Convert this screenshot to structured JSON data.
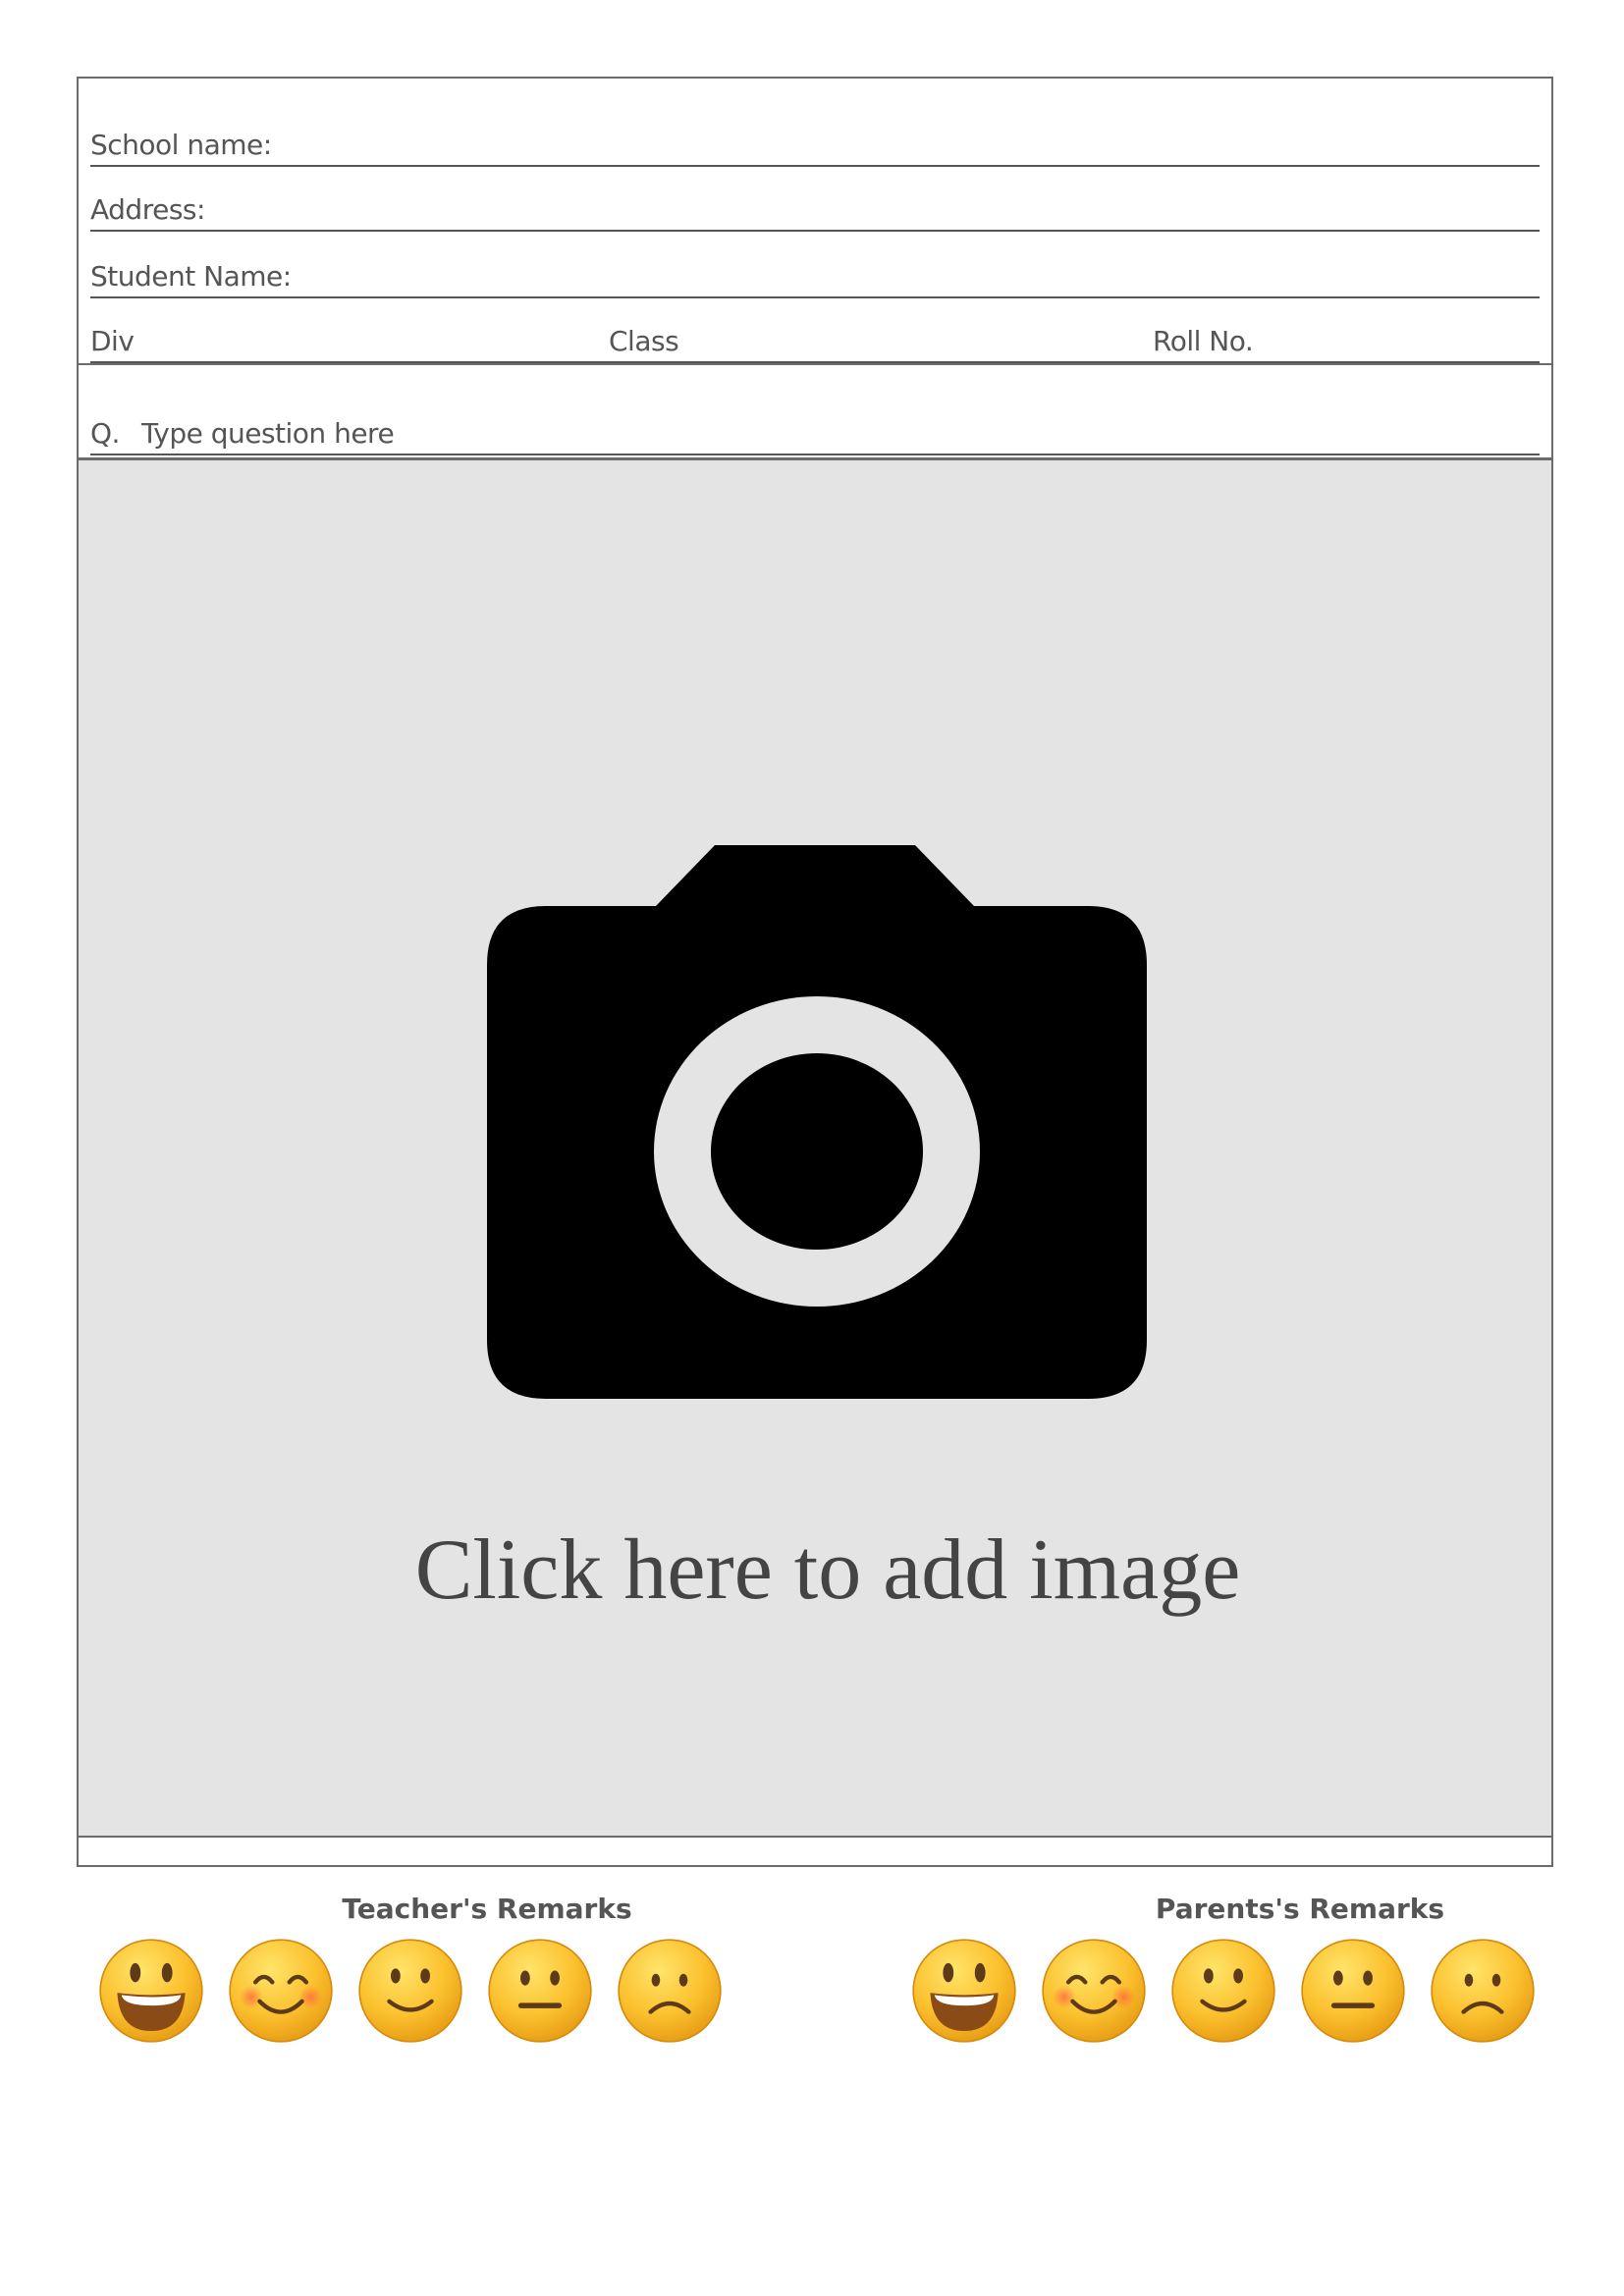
{
  "form": {
    "school_label": "School name:",
    "address_label": "Address:",
    "student_label": "Student Name:",
    "div_label": "Div",
    "class_label": "Class",
    "roll_label": "Roll No.",
    "question_number": "Q.",
    "question_placeholder": "Type question here"
  },
  "image_area": {
    "add_text": "Click here to add image",
    "icon": "camera-icon",
    "background": "#e4e4e4"
  },
  "remarks": {
    "teacher_title": "Teacher's Remarks",
    "parent_title": "Parents's Remarks",
    "emojis": [
      "grinning-face",
      "smiling-blushing-face",
      "slightly-smiling-face",
      "neutral-face",
      "frowning-face"
    ]
  }
}
